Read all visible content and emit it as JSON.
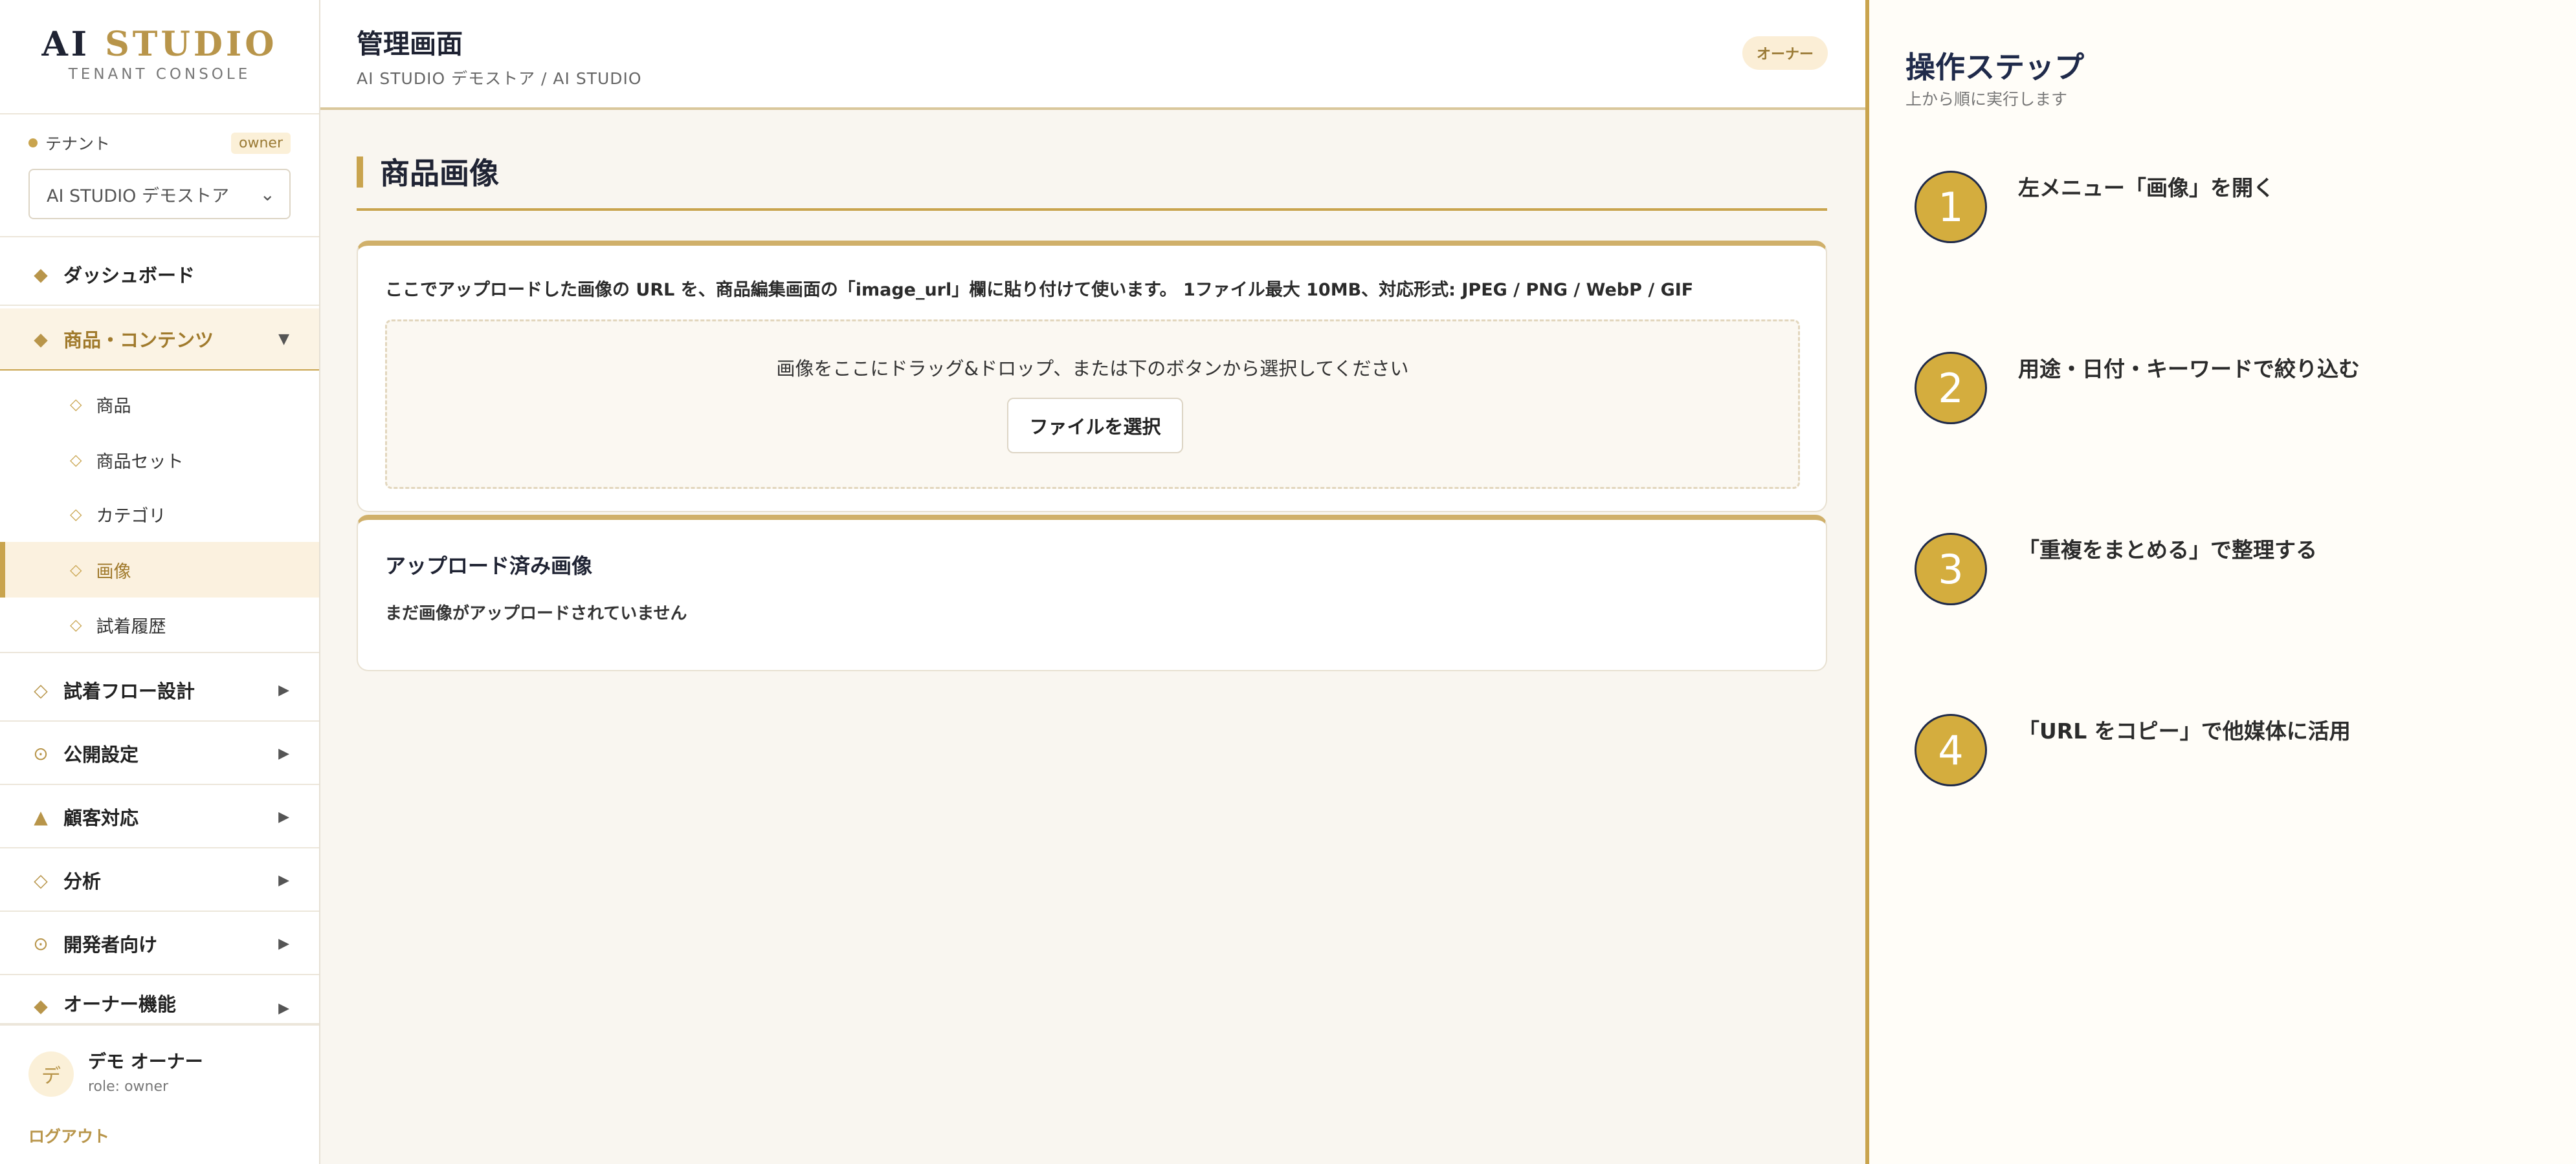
{
  "brand": {
    "title_a": "AI",
    "title_b": "STUDIO",
    "subtitle": "TENANT CONSOLE"
  },
  "tenant": {
    "label": "テナント",
    "role_badge": "owner",
    "selected": "AI STUDIO デモストア"
  },
  "nav": {
    "dashboard": "ダッシュボード",
    "products_contents": "商品・コンテンツ",
    "sub": {
      "products": "商品",
      "product_sets": "商品セット",
      "categories": "カテゴリ",
      "images": "画像",
      "tryon_history": "試着履歴"
    },
    "flow_design": "試着フロー設計",
    "publish": "公開設定",
    "customer": "顧客対応",
    "analytics": "分析",
    "developer": "開発者向け",
    "owner_features": "オーナー機能"
  },
  "user": {
    "initial": "デ",
    "name": "デモ オーナー",
    "role": "role: owner",
    "logout": "ログアウト"
  },
  "header": {
    "title": "管理画面",
    "breadcrumb": "AI STUDIO デモストア / AI STUDIO",
    "badge": "オーナー"
  },
  "page": {
    "title": "商品画像"
  },
  "upload": {
    "description": "ここでアップロードした画像の URL を、商品編集画面の「image_url」欄に貼り付けて使います。 1ファイル最大 10MB、対応形式: JPEG / PNG / WebP / GIF",
    "dropzone_text": "画像をここにドラッグ&ドロップ、または下のボタンから選択してください",
    "button": "ファイルを選択"
  },
  "uploaded": {
    "title": "アップロード済み画像",
    "empty": "まだ画像がアップロードされていません"
  },
  "steps": {
    "title": "操作ステップ",
    "subtitle": "上から順に実行します",
    "items": [
      {
        "num": "1",
        "text": "左メニュー「画像」を開く"
      },
      {
        "num": "2",
        "text": "用途・日付・キーワードで絞り込む"
      },
      {
        "num": "3",
        "text": "「重複をまとめる」で整理する"
      },
      {
        "num": "4",
        "text": "「URL をコピー」で他媒体に活用"
      }
    ]
  },
  "colors": {
    "accent": "#c9a44e",
    "navy": "#1f2a4a",
    "background": "#f9f6f0"
  }
}
